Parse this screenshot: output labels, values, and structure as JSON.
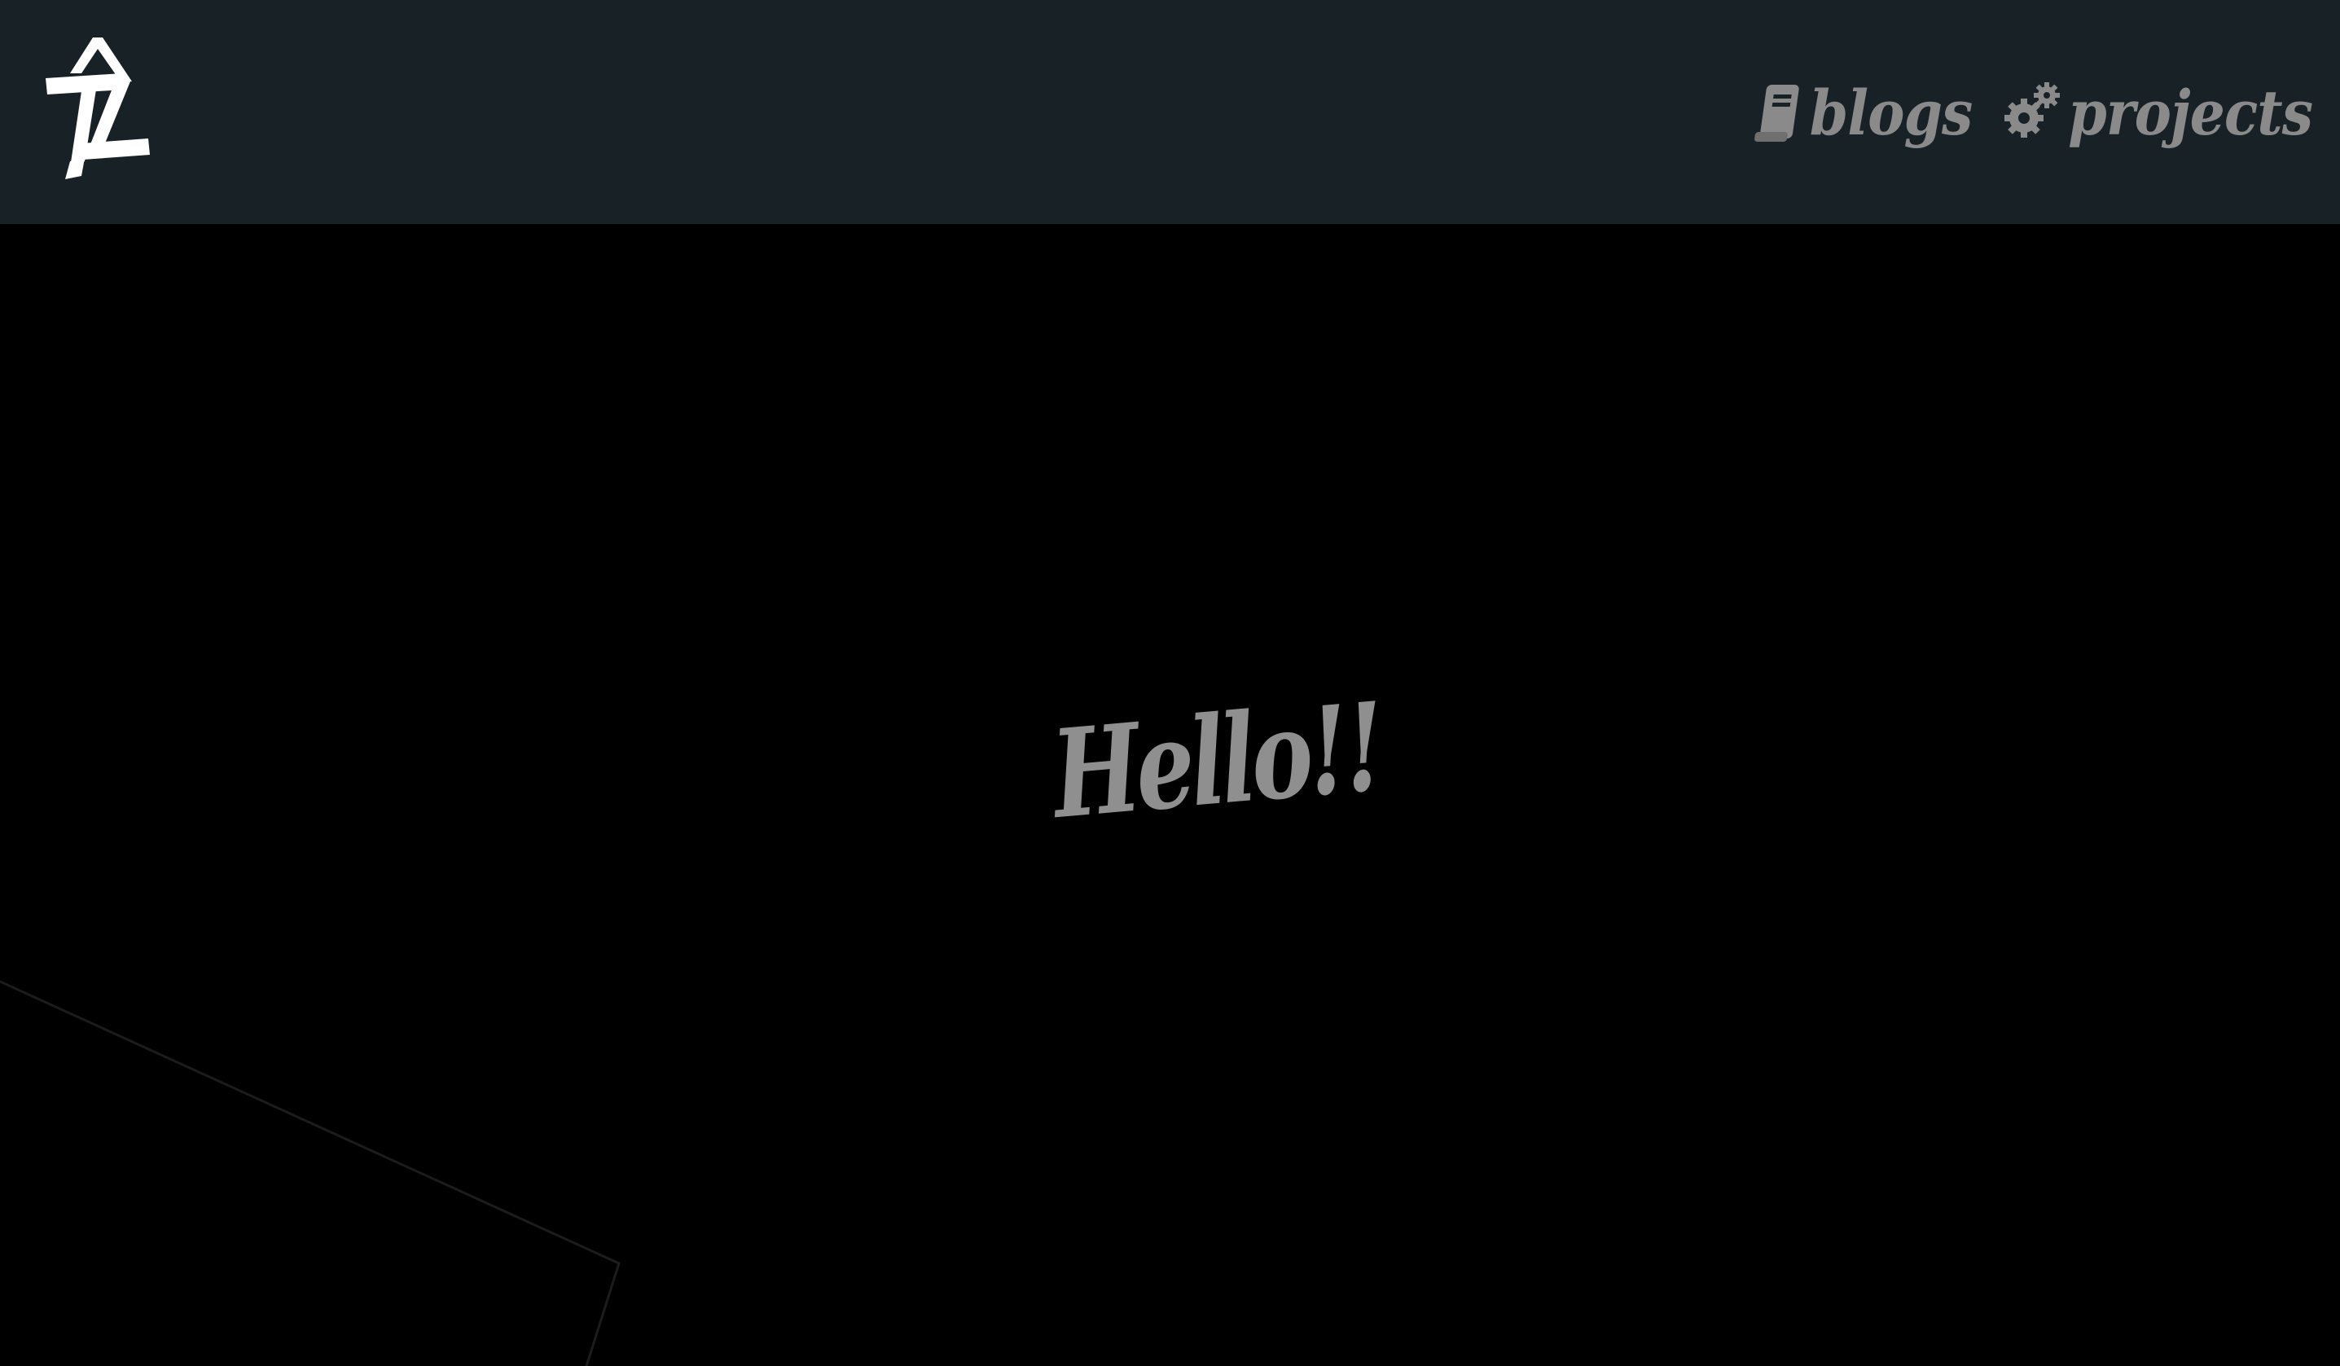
{
  "header": {
    "logo_icon": "zt-monogram-logo",
    "nav": [
      {
        "icon": "book-icon",
        "label": "blogs"
      },
      {
        "icon": "gears-icon",
        "label": "projects"
      }
    ]
  },
  "hero": {
    "title": "Hello!!"
  },
  "colors": {
    "header_bg": "#182126",
    "page_bg": "#000000",
    "text_gray": "#8a8a8a",
    "logo": "#ffffff"
  }
}
